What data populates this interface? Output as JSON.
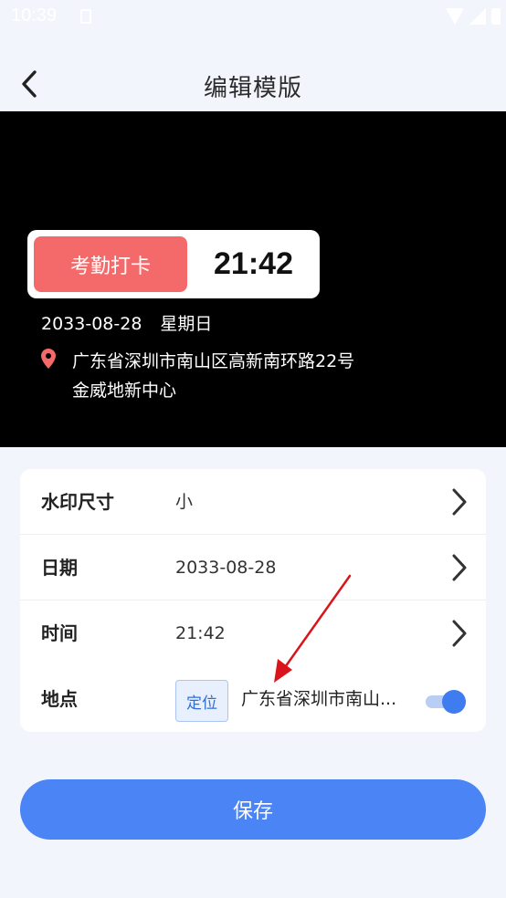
{
  "status_bar": {
    "time": "10:39"
  },
  "header": {
    "title": "编辑模版"
  },
  "preview": {
    "badge": "考勤打卡",
    "time": "21:42",
    "date": "2033-08-28",
    "weekday": "星期日",
    "address_line1": "广东省深圳市南山区高新南环路22号",
    "address_line2": "金威地新中心"
  },
  "settings": {
    "size": {
      "label": "水印尺寸",
      "value": "小"
    },
    "date": {
      "label": "日期",
      "value": "2033-08-28"
    },
    "time": {
      "label": "时间",
      "value": "21:42"
    },
    "location": {
      "label": "地点",
      "locate_button": "定位",
      "value": "广东省深圳市南山...",
      "toggle_on": true
    }
  },
  "save_button": "保存",
  "colors": {
    "accent": "#4a84f5",
    "badge_red": "#f46a6a",
    "annotation_arrow": "#d9151b",
    "background": "#f2f6fc"
  }
}
